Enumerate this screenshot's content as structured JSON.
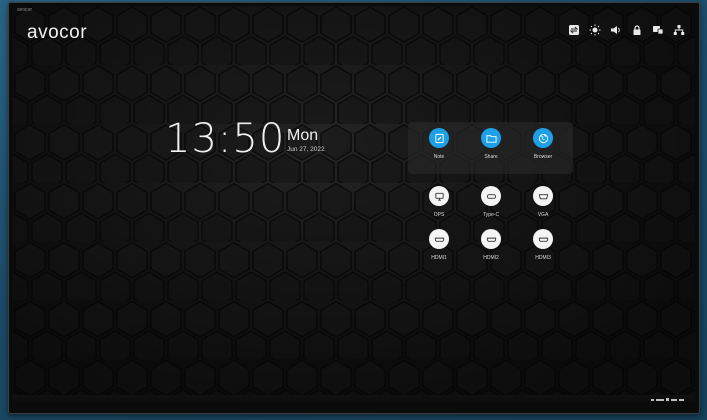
{
  "screen": {
    "corner_label": "avocor",
    "brand": "avocor"
  },
  "status_icons": [
    "input-switch-icon",
    "brightness-icon",
    "volume-icon",
    "lock-icon",
    "screen-mirror-icon",
    "network-icon"
  ],
  "clock": {
    "time": "13:50",
    "day": "Mon",
    "date": "Jun 27, 2022"
  },
  "apps": [
    {
      "label": "Note",
      "icon": "note-icon"
    },
    {
      "label": "Share",
      "icon": "folder-icon"
    },
    {
      "label": "Browser",
      "icon": "globe-icon"
    }
  ],
  "sources": [
    {
      "label": "OPS",
      "icon": "ops-icon"
    },
    {
      "label": "Type-C",
      "icon": "type-c-icon"
    },
    {
      "label": "VGA",
      "icon": "vga-icon"
    },
    {
      "label": "HDMI1",
      "icon": "hdmi-icon"
    },
    {
      "label": "HDMI2",
      "icon": "hdmi-icon"
    },
    {
      "label": "HDMI3",
      "icon": "hdmi-icon"
    }
  ],
  "colors": {
    "accent": "#1ea0e8",
    "screen_bg": "#151515",
    "wall": "#1f4f6b"
  }
}
